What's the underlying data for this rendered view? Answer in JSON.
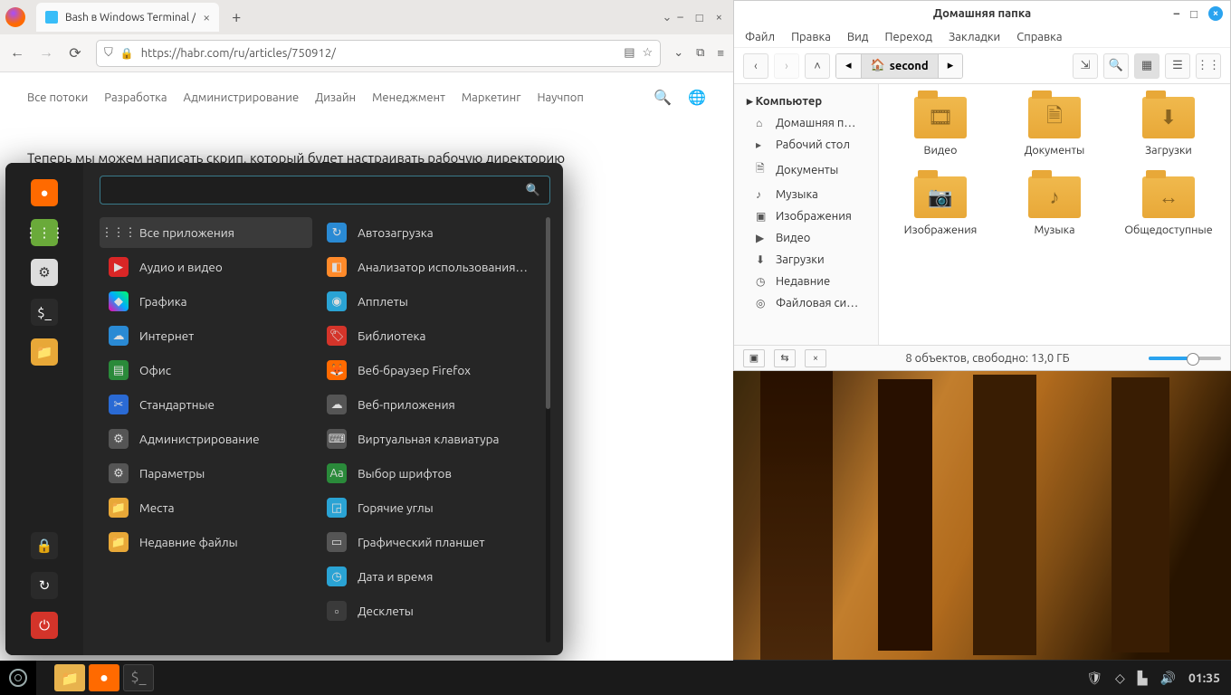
{
  "firefox": {
    "tab_title": "Bash в Windows Terminal /",
    "url": "https://habr.com/ru/articles/750912/",
    "nav": [
      "Все потоки",
      "Разработка",
      "Администрирование",
      "Дизайн",
      "Менеджмент",
      "Маркетинг",
      "Научпоп"
    ],
    "article_line": "Теперь мы можем написать скрип, который будет настраивать рабочую директорию"
  },
  "filemanager": {
    "title": "Домашняя папка",
    "menus": [
      "Файл",
      "Правка",
      "Вид",
      "Переход",
      "Закладки",
      "Справка"
    ],
    "path_segment": "second",
    "sidebar_header": "Компьютер",
    "sidebar": [
      {
        "icon": "⌂",
        "label": "Домашняя п…"
      },
      {
        "icon": "▸",
        "label": "Рабочий стол"
      },
      {
        "icon": "🗎",
        "label": "Документы"
      },
      {
        "icon": "♪",
        "label": "Музыка"
      },
      {
        "icon": "▣",
        "label": "Изображения"
      },
      {
        "icon": "▶",
        "label": "Видео"
      },
      {
        "icon": "⬇",
        "label": "Загрузки"
      },
      {
        "icon": "◷",
        "label": "Недавние"
      },
      {
        "icon": "◎",
        "label": "Файловая си…"
      }
    ],
    "folders": [
      {
        "icon": "🎞",
        "label": "Видео"
      },
      {
        "icon": "🗎",
        "label": "Документы"
      },
      {
        "icon": "⬇",
        "label": "Загрузки"
      },
      {
        "icon": "📷",
        "label": "Изображения"
      },
      {
        "icon": "♪",
        "label": "Музыка"
      },
      {
        "icon": "↔",
        "label": "Общедоступные"
      }
    ],
    "status": "8 объектов, свободно: 13,0 ГБ"
  },
  "appmenu": {
    "categories": [
      {
        "icon": "⋮⋮⋮",
        "bg": "#3a3a3a",
        "label": "Все приложения",
        "sel": true
      },
      {
        "icon": "▶",
        "bg": "#d92626",
        "label": "Аудио и видео"
      },
      {
        "icon": "◆",
        "bg": "linear-gradient(45deg,#f0a,#0af,#0f6)",
        "label": "Графика"
      },
      {
        "icon": "☁",
        "bg": "#2a8ad4",
        "label": "Интернет"
      },
      {
        "icon": "▤",
        "bg": "#2a8a3a",
        "label": "Офис"
      },
      {
        "icon": "✂",
        "bg": "#2a6ad4",
        "label": "Стандартные"
      },
      {
        "icon": "⚙",
        "bg": "#555",
        "label": "Администрирование"
      },
      {
        "icon": "⚙",
        "bg": "#555",
        "label": "Параметры"
      },
      {
        "icon": "📁",
        "bg": "#e8a838",
        "label": "Места"
      },
      {
        "icon": "📁",
        "bg": "#e8a838",
        "label": "Недавние файлы"
      }
    ],
    "apps": [
      {
        "icon": "↻",
        "bg": "#2a8ad4",
        "label": "Автозагрузка"
      },
      {
        "icon": "◧",
        "bg": "#ff8a2a",
        "label": "Анализатор использования…"
      },
      {
        "icon": "◉",
        "bg": "#2aa3d4",
        "label": "Апплеты"
      },
      {
        "icon": "🏷",
        "bg": "#d4342a",
        "label": "Библиотека"
      },
      {
        "icon": "🦊",
        "bg": "#ff6a00",
        "label": "Веб-браузер Firefox"
      },
      {
        "icon": "☁",
        "bg": "#555",
        "label": "Веб-приложения"
      },
      {
        "icon": "⌨",
        "bg": "#555",
        "label": "Виртуальная клавиатура"
      },
      {
        "icon": "Аа",
        "bg": "#2a8a3a",
        "label": "Выбор шрифтов"
      },
      {
        "icon": "◲",
        "bg": "#2aa3d4",
        "label": "Горячие углы"
      },
      {
        "icon": "▭",
        "bg": "#555",
        "label": "Графический планшет"
      },
      {
        "icon": "◷",
        "bg": "#2aa3d4",
        "label": "Дата и время"
      },
      {
        "icon": "▫",
        "bg": "#3a3a3a",
        "label": "Десклеты"
      }
    ],
    "favorites": [
      {
        "name": "firefox",
        "bg": "#ff6a00",
        "icon": "●"
      },
      {
        "name": "software",
        "bg": "#6aaa3a",
        "icon": "⋮⋮⋮"
      },
      {
        "name": "settings",
        "bg": "#ddd",
        "icon": "⚙",
        "fg": "#333"
      },
      {
        "name": "terminal",
        "bg": "#2a2a2a",
        "icon": "$_"
      },
      {
        "name": "files",
        "bg": "#e8a838",
        "icon": "📁"
      }
    ],
    "bottom": [
      {
        "name": "lock",
        "bg": "#2a2a2a",
        "icon": "🔒"
      },
      {
        "name": "logout",
        "bg": "#2a2a2a",
        "icon": "↻"
      },
      {
        "name": "power",
        "bg": "#d4342a",
        "icon": "⏻"
      }
    ]
  },
  "taskbar": {
    "clock": "01:35"
  }
}
